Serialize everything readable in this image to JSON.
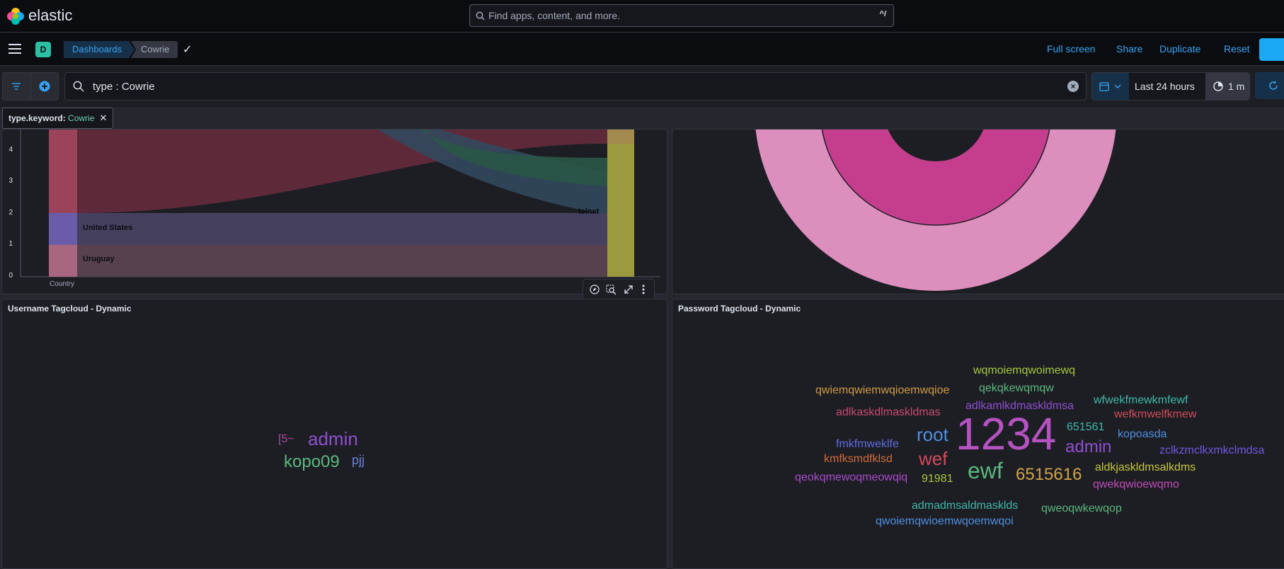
{
  "header": {
    "brand": "elastic",
    "search_placeholder": "Find apps, content, and more.",
    "search_shortcut": "^/"
  },
  "nav": {
    "space_initial": "D",
    "breadcrumbs": [
      "Dashboards",
      "Cowrie"
    ],
    "actions": [
      "Full screen",
      "Share",
      "Duplicate",
      "Reset"
    ]
  },
  "query": {
    "text": "type : Cowrie",
    "time_range": "Last 24 hours",
    "refresh_interval": "1 m"
  },
  "filter_pill": {
    "field": "type.keyword:",
    "value": "Cowrie"
  },
  "panels": {
    "sankey": {
      "y_ticks": [
        "4",
        "3",
        "2",
        "1",
        "0"
      ],
      "labels": [
        "United States",
        "Uruguay",
        "telnet"
      ],
      "axis_label": "Country"
    },
    "username_title": "Username Tagcloud - Dynamic",
    "password_title": "Password Tagcloud - Dynamic"
  },
  "username_words": [
    {
      "text": "[5~",
      "color": "#b0479f"
    },
    {
      "text": "admin",
      "color": "#8e4fcf"
    },
    {
      "text": "kopo09",
      "color": "#5bb77d"
    },
    {
      "text": "pjj",
      "color": "#6a7fd6"
    }
  ],
  "password_words": [
    {
      "text": "wqmoiemqwoimewq",
      "color": "#a6c83d"
    },
    {
      "text": "qwiemqwiemwqioemwqioe",
      "color": "#d19a45"
    },
    {
      "text": "qekqkewqmqw",
      "color": "#5bb77d"
    },
    {
      "text": "wfwekfmewkmfewf",
      "color": "#3fb7a6"
    },
    {
      "text": "adlkamlkdmaskldmsa",
      "color": "#8e4fcf"
    },
    {
      "text": "adlkaskdlmaskldmas",
      "color": "#c9496e"
    },
    {
      "text": "wefkmwelfkmew",
      "color": "#d04a5b"
    },
    {
      "text": "651561",
      "color": "#3fb7a6"
    },
    {
      "text": "root",
      "color": "#4f8fe0"
    },
    {
      "text": "1234",
      "color": "#b452c1"
    },
    {
      "text": "kopoasda",
      "color": "#4f8fe0"
    },
    {
      "text": "fmkfmweklfe",
      "color": "#5d6be0"
    },
    {
      "text": "admin",
      "color": "#8e4fcf"
    },
    {
      "text": "zclkzmclkxmkclmdsa",
      "color": "#7058e0"
    },
    {
      "text": "kmfksmdfklsd",
      "color": "#d06a3a"
    },
    {
      "text": "wef",
      "color": "#d04a5b"
    },
    {
      "text": "ewf",
      "color": "#5bb77d"
    },
    {
      "text": "6515616",
      "color": "#d1a245"
    },
    {
      "text": "aldkjaskldmsalkdms",
      "color": "#c6c63d"
    },
    {
      "text": "qeokqmewoqmeowqiq",
      "color": "#a84bc9"
    },
    {
      "text": "91981",
      "color": "#a6c83d"
    },
    {
      "text": "qwekqwioewqmo",
      "color": "#c24bb7"
    },
    {
      "text": "admadmsaldmasklds",
      "color": "#3fb7a6"
    },
    {
      "text": "qweoqwkewqop",
      "color": "#5bb77d"
    },
    {
      "text": "qwoiemqwioemwqoemwqoi",
      "color": "#4f8fe0"
    }
  ]
}
